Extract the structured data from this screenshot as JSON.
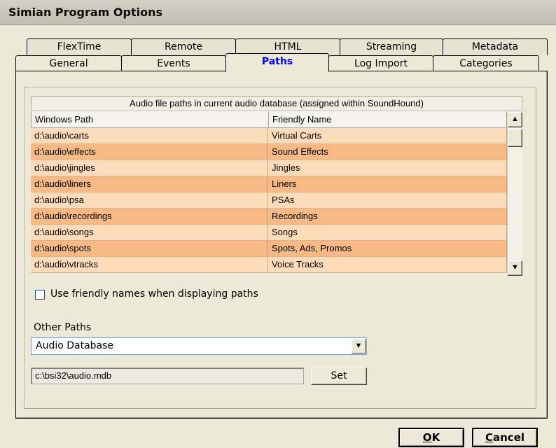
{
  "window": {
    "title": "Simian Program Options"
  },
  "tabs_back": [
    "FlexTime",
    "Remote",
    "HTML",
    "Streaming",
    "Metadata"
  ],
  "tabs_front": [
    "General",
    "Events",
    "Paths",
    "Log Import",
    "Categories"
  ],
  "active_tab": "Paths",
  "grid": {
    "caption": "Audio file paths in current audio database (assigned within SoundHound)",
    "columns": [
      "Windows Path",
      "Friendly Name"
    ],
    "rows": [
      {
        "path": "d:\\audio\\carts",
        "name": "Virtual Carts"
      },
      {
        "path": "d:\\audio\\effects",
        "name": "Sound Effects"
      },
      {
        "path": "d:\\audio\\jingles",
        "name": "Jingles"
      },
      {
        "path": "d:\\audio\\liners",
        "name": "Liners"
      },
      {
        "path": "d:\\audio\\psa",
        "name": "PSAs"
      },
      {
        "path": "d:\\audio\\recordings",
        "name": "Recordings"
      },
      {
        "path": "d:\\audio\\songs",
        "name": "Songs"
      },
      {
        "path": "d:\\audio\\spots",
        "name": "Spots, Ads, Promos"
      },
      {
        "path": "d:\\audio\\vtracks",
        "name": "Voice Tracks"
      }
    ]
  },
  "friendly_checkbox": {
    "label": "Use friendly names when displaying paths",
    "checked": false
  },
  "other_paths": {
    "label": "Other Paths",
    "selected": "Audio Database",
    "path_value": "c:\\bsi32\\audio.mdb",
    "set_label": "Set"
  },
  "buttons": {
    "ok_accel": "O",
    "ok_rest": "K",
    "cancel_accel": "C",
    "cancel_rest": "ancel"
  },
  "icons": {
    "scroll_up": "scroll-up-arrow-icon",
    "scroll_down": "scroll-down-arrow-icon",
    "dropdown": "dropdown-arrow-icon"
  },
  "colors": {
    "row_light": "#fddcbb",
    "row_dark": "#f8b985",
    "active_tab_text": "#0000ff",
    "window_bg": "#ece9d8"
  }
}
